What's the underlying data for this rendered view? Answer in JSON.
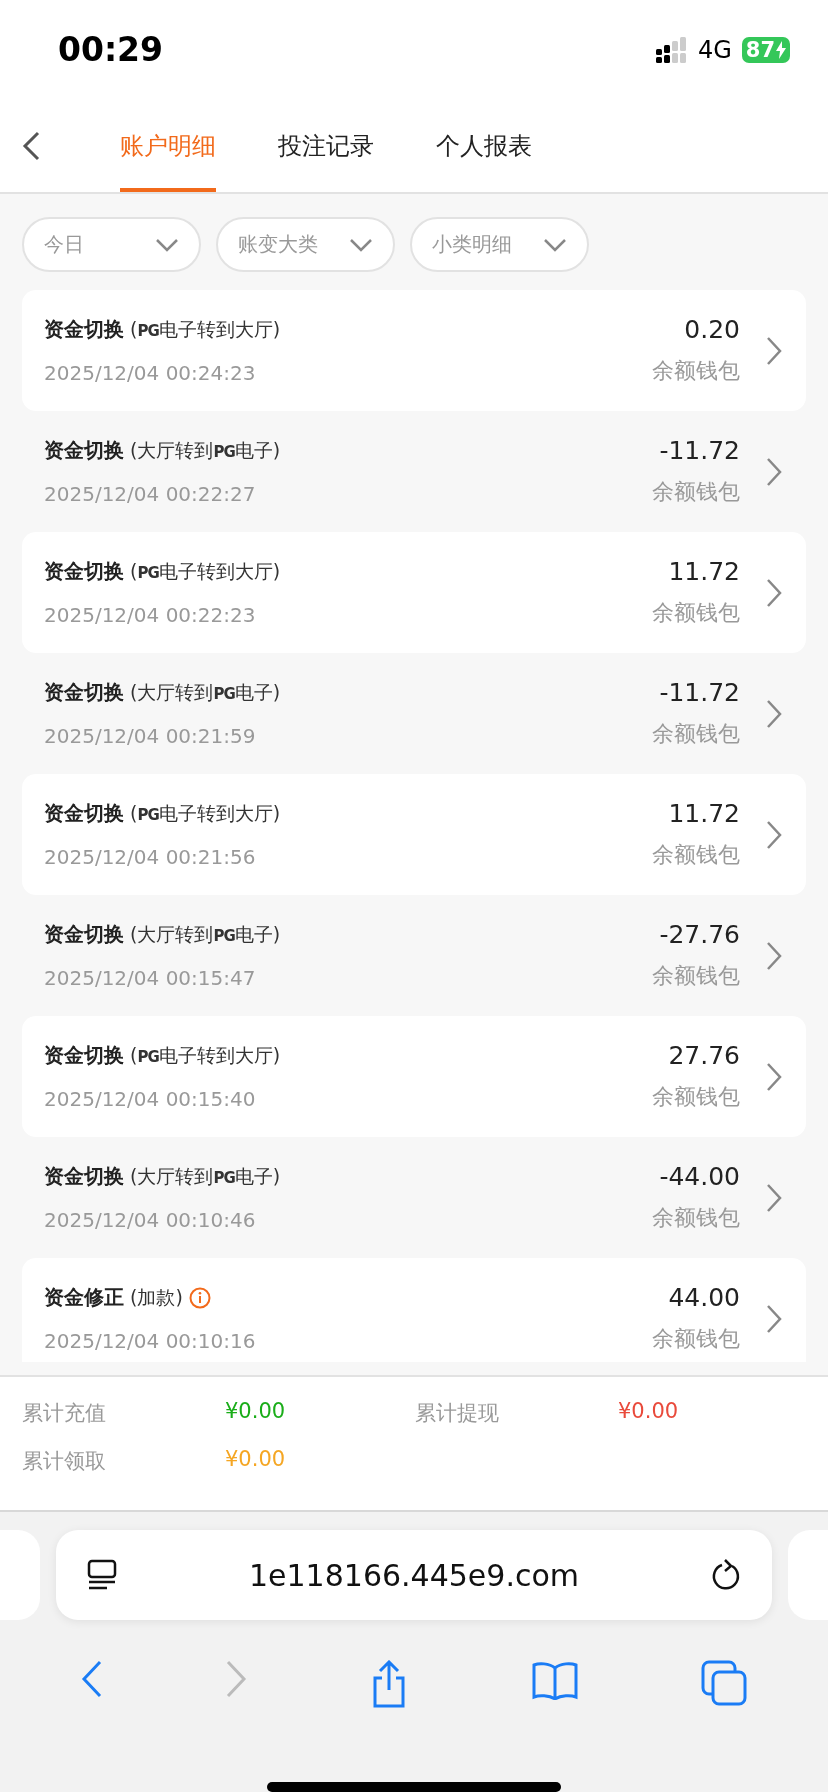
{
  "status_bar": {
    "time": "00:29",
    "network": "4G",
    "battery": "87",
    "charging": true
  },
  "tabs": [
    {
      "label": "账户明细",
      "selected": true
    },
    {
      "label": "投注记录",
      "selected": false
    },
    {
      "label": "个人报表",
      "selected": false
    }
  ],
  "filters": [
    {
      "label": "今日"
    },
    {
      "label": "账变大类"
    },
    {
      "label": "小类明细"
    }
  ],
  "records": [
    {
      "title": "资金切换",
      "detail": "(**PG**电子转到大厅)",
      "time": "2025/12/04 00:24:23",
      "amount": "0.20",
      "wallet": "余额钱包",
      "info": false
    },
    {
      "title": "资金切换",
      "detail": "(大厅转到**PG**电子)",
      "time": "2025/12/04 00:22:27",
      "amount": "-11.72",
      "wallet": "余额钱包",
      "info": false
    },
    {
      "title": "资金切换",
      "detail": "(**PG**电子转到大厅)",
      "time": "2025/12/04 00:22:23",
      "amount": "11.72",
      "wallet": "余额钱包",
      "info": false
    },
    {
      "title": "资金切换",
      "detail": "(大厅转到**PG**电子)",
      "time": "2025/12/04 00:21:59",
      "amount": "-11.72",
      "wallet": "余额钱包",
      "info": false
    },
    {
      "title": "资金切换",
      "detail": "(**PG**电子转到大厅)",
      "time": "2025/12/04 00:21:56",
      "amount": "11.72",
      "wallet": "余额钱包",
      "info": false
    },
    {
      "title": "资金切换",
      "detail": "(大厅转到**PG**电子)",
      "time": "2025/12/04 00:15:47",
      "amount": "-27.76",
      "wallet": "余额钱包",
      "info": false
    },
    {
      "title": "资金切换",
      "detail": "(**PG**电子转到大厅)",
      "time": "2025/12/04 00:15:40",
      "amount": "27.76",
      "wallet": "余额钱包",
      "info": false
    },
    {
      "title": "资金切换",
      "detail": "(大厅转到**PG**电子)",
      "time": "2025/12/04 00:10:46",
      "amount": "-44.00",
      "wallet": "余额钱包",
      "info": false
    },
    {
      "title": "资金修正",
      "detail": "(加款)",
      "time": "2025/12/04 00:10:16",
      "amount": "44.00",
      "wallet": "余额钱包",
      "info": true
    }
  ],
  "summary": [
    {
      "label": "累计充值",
      "value": "¥0.00",
      "color": "#1aad19"
    },
    {
      "label": "累计提现",
      "value": "¥0.00",
      "color": "#e94a3b"
    },
    {
      "label": "累计领取",
      "value": "¥0.00",
      "color": "#f5a623"
    }
  ],
  "browser": {
    "url": "1e118166.445e9.com"
  }
}
